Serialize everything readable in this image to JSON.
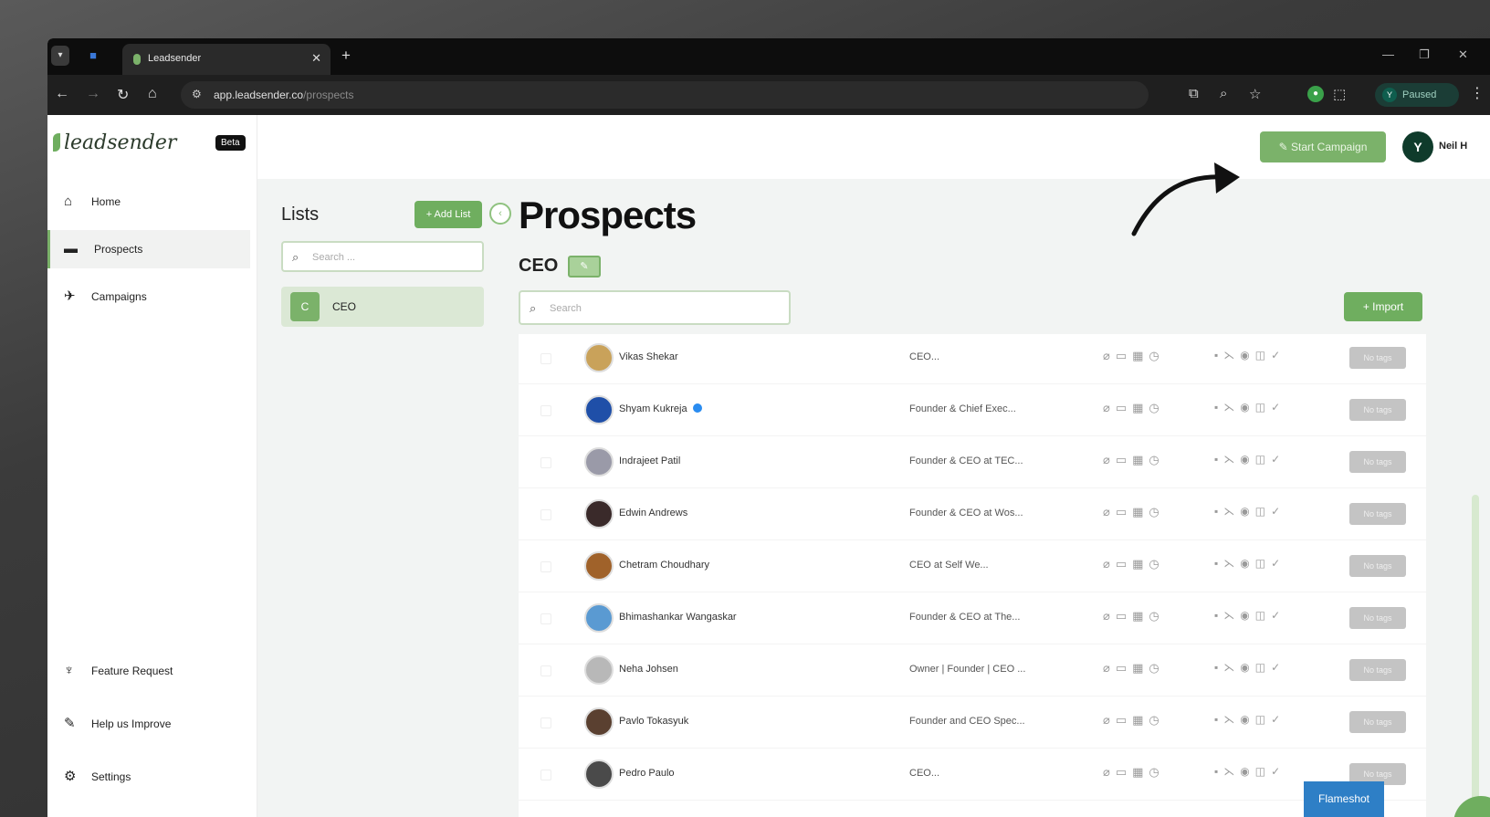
{
  "browser": {
    "tab_title": "Leadsender",
    "url_host": "app.leadsender.co",
    "url_path": "/prospects",
    "profile_initial": "Y",
    "profile_status": "Paused"
  },
  "app": {
    "logo_text": "leadsender",
    "beta_label": "Beta",
    "nav": [
      {
        "label": "Home",
        "icon": "home-icon"
      },
      {
        "label": "Prospects",
        "icon": "users-icon"
      },
      {
        "label": "Campaigns",
        "icon": "rocket-icon"
      }
    ],
    "nav_bottom": [
      {
        "label": "Feature Request",
        "icon": "bulb-icon"
      },
      {
        "label": "Help us Improve",
        "icon": "feedback-icon"
      },
      {
        "label": "Settings",
        "icon": "gear-icon"
      }
    ],
    "start_campaign_label": "Start Campaign",
    "user_initial": "Y",
    "user_name": "Neil H"
  },
  "lists": {
    "title": "Lists",
    "add_list_label": "+ Add List",
    "search_placeholder": "Search ...",
    "items": [
      {
        "initial": "C",
        "name": "CEO"
      }
    ]
  },
  "prospects": {
    "title": "Prospects",
    "list_name": "CEO",
    "search_placeholder": "Search",
    "import_label": "+ Import",
    "tag_label": "No tags",
    "rows": [
      {
        "name": "Vikas Shekar",
        "title": "CEO...",
        "verified": false,
        "avatar_color": "#c9a25a"
      },
      {
        "name": "Shyam Kukreja",
        "title": "Founder & Chief Exec...",
        "verified": true,
        "avatar_color": "#1f4fa8"
      },
      {
        "name": "Indrajeet Patil",
        "title": "Founder & CEO at TEC...",
        "verified": false,
        "avatar_color": "#9a9aa8"
      },
      {
        "name": "Edwin Andrews",
        "title": "Founder & CEO at Wos...",
        "verified": false,
        "avatar_color": "#3a2a2a"
      },
      {
        "name": "Chetram Choudhary",
        "title": "CEO at Self We...",
        "verified": false,
        "avatar_color": "#a0622a"
      },
      {
        "name": "Bhimashankar Wangaskar",
        "title": "Founder & CEO at The...",
        "verified": false,
        "avatar_color": "#5a9ad2"
      },
      {
        "name": "Neha Johsen",
        "title": "Owner | Founder | CEO ...",
        "verified": false,
        "avatar_color": "#b8b8b8"
      },
      {
        "name": "Pavlo Tokasyuk",
        "title": "Founder and CEO Spec...",
        "verified": false,
        "avatar_color": "#5a4030"
      },
      {
        "name": "Pedro Paulo",
        "title": "CEO...",
        "verified": false,
        "avatar_color": "#4a4a4a"
      }
    ]
  },
  "overlay": {
    "flameshot_label": "Flameshot"
  }
}
